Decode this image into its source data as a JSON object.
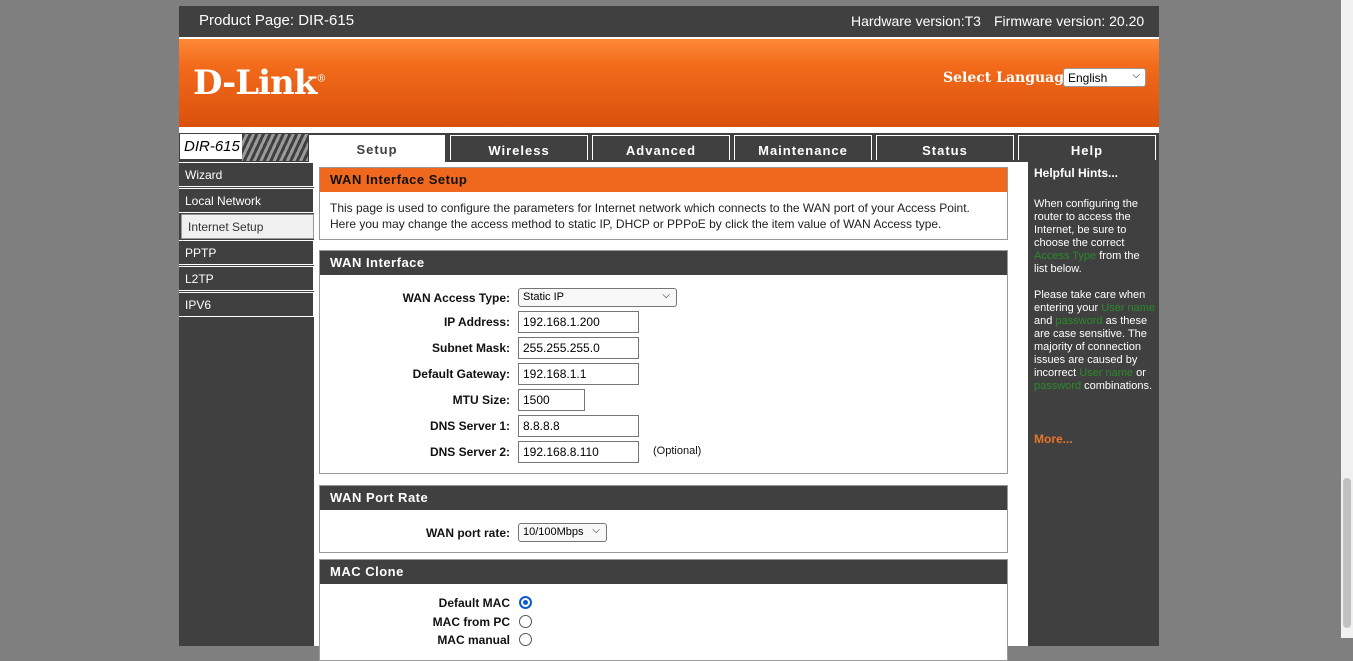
{
  "header": {
    "product": "Product Page: DIR-615",
    "hardware": "Hardware version:T3",
    "firmware": "Firmware version: 20.20"
  },
  "banner": {
    "logo": "D-Link",
    "logo_mark": "®",
    "language_label": "Select Language",
    "language_value": "English"
  },
  "model_label": "DIR-615",
  "tabs": [
    "Setup",
    "Wireless",
    "Advanced",
    "Maintenance",
    "Status",
    "Help"
  ],
  "sidebar": [
    "Wizard",
    "Local Network",
    "Internet Setup",
    "PPTP",
    "L2TP",
    "IPV6"
  ],
  "wan_setup": {
    "title": "WAN Interface Setup",
    "description": "This page is used to configure the parameters for Internet network which connects to the WAN port of your Access Point. Here you may change the access method to static IP, DHCP or PPPoE by click the item value of WAN Access type."
  },
  "wan_interface": {
    "title": "WAN Interface",
    "access_type_label": "WAN Access Type:",
    "access_type_value": "Static IP",
    "ip_label": "IP Address:",
    "ip_value": "192.168.1.200",
    "mask_label": "Subnet Mask:",
    "mask_value": "255.255.255.0",
    "gateway_label": "Default Gateway:",
    "gateway_value": "192.168.1.1",
    "mtu_label": "MTU Size:",
    "mtu_value": "1500",
    "dns1_label": "DNS Server 1:",
    "dns1_value": "8.8.8.8",
    "dns2_label": "DNS Server 2:",
    "dns2_value": "192.168.8.110",
    "optional": "(Optional)"
  },
  "port_rate": {
    "title": "WAN Port Rate",
    "label": "WAN port rate:",
    "value": "10/100Mbps"
  },
  "mac_clone": {
    "title": "MAC Clone",
    "default_mac": "Default MAC",
    "mac_from_pc": "MAC from PC",
    "mac_manual": "MAC manual",
    "selected": "Default MAC"
  },
  "hints": {
    "title": "Helpful Hints...",
    "p1_a": "When configuring the router to access the Internet, be sure to choose the correct",
    "p1_hl": "Access Type",
    "p1_b": "from the list below.",
    "p2_a": "Please take care when entering your",
    "p2_hl1": "User name",
    "p2_and": "and",
    "p2_hl2": "password",
    "p2_b": "as these are case sensitive. The majority of connection issues are caused by incorrect",
    "p2_hl3": "User name",
    "p2_or": "or",
    "p2_hl4": "password",
    "p2_c": "combinations.",
    "more": "More..."
  },
  "colors": {
    "banner_orange": "#f26a1a",
    "dark_gray": "#404040",
    "hint_green": "#2a8a2a",
    "more_orange": "#e8752a"
  }
}
